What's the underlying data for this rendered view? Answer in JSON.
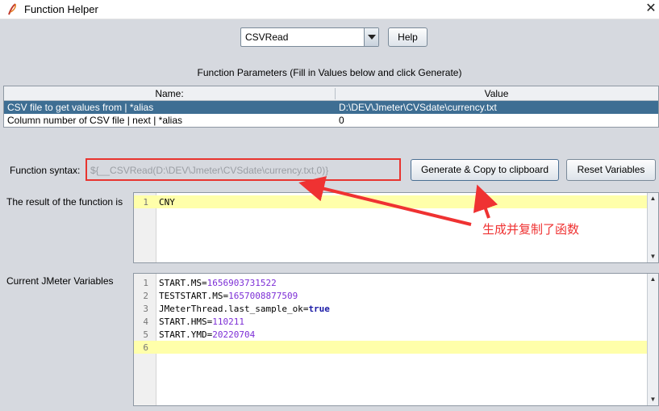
{
  "window": {
    "title": "Function Helper",
    "close_glyph": "✕",
    "icon": "feather-icon"
  },
  "function_select": {
    "selected": "CSVRead"
  },
  "help_button": "Help",
  "parameters": {
    "heading": "Function Parameters (Fill in Values below and click Generate)",
    "columns": [
      "Name:",
      "Value"
    ],
    "rows": [
      {
        "name": "CSV file to get values from | *alias",
        "value": "D:\\DEV\\Jmeter\\CVSdate\\currency.txt"
      },
      {
        "name": "Column number of CSV file | next | *alias",
        "value": "0"
      }
    ]
  },
  "syntax": {
    "label": "Function syntax:",
    "value": "${__CSVRead(D:\\DEV\\Jmeter\\CVSdate\\currency.txt,0)}"
  },
  "buttons": {
    "generate": "Generate & Copy to clipboard",
    "reset": "Reset Variables"
  },
  "result": {
    "label": "The result of the function is",
    "lines": [
      {
        "num": "1",
        "text": "CNY"
      }
    ]
  },
  "variables": {
    "label": "Current JMeter Variables",
    "lines": [
      {
        "num": "1",
        "key": "START.MS",
        "value": "1656903731522",
        "kind": "num"
      },
      {
        "num": "2",
        "key": "TESTSTART.MS",
        "value": "1657008877509",
        "kind": "num"
      },
      {
        "num": "3",
        "key": "JMeterThread.last_sample_ok",
        "value": "true",
        "kind": "kw"
      },
      {
        "num": "4",
        "key": "START.HMS",
        "value": "110211",
        "kind": "num"
      },
      {
        "num": "5",
        "key": "START.YMD",
        "value": "20220704",
        "kind": "num"
      },
      {
        "num": "6",
        "key": "",
        "value": "",
        "kind": ""
      }
    ]
  },
  "annotation": {
    "text": "生成并复制了函数",
    "color": "#ef3232"
  },
  "colors": {
    "selection": "#3e6e93",
    "highlight": "#ffffaa",
    "annotation_red": "#e8342f"
  }
}
